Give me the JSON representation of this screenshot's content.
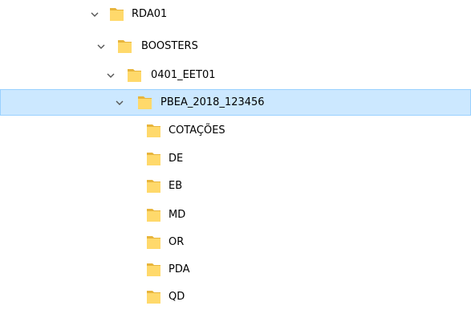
{
  "colors": {
    "selection_bg": "#cce8ff",
    "selection_border": "#99d1ff",
    "folder_body": "#ffd96b",
    "folder_back": "#e8b53c",
    "chevron": "#555555"
  },
  "tree": {
    "nodes": [
      {
        "label": "RDA01",
        "expanded": true,
        "selected": false
      },
      {
        "label": "BOOSTERS",
        "expanded": true,
        "selected": false
      },
      {
        "label": "0401_EET01",
        "expanded": true,
        "selected": false
      },
      {
        "label": "PBEA_2018_123456",
        "expanded": true,
        "selected": true
      },
      {
        "label": "COTAÇÕES",
        "expanded": false,
        "selected": false
      },
      {
        "label": "DE",
        "expanded": false,
        "selected": false
      },
      {
        "label": "EB",
        "expanded": false,
        "selected": false
      },
      {
        "label": "MD",
        "expanded": false,
        "selected": false
      },
      {
        "label": "OR",
        "expanded": false,
        "selected": false
      },
      {
        "label": "PDA",
        "expanded": false,
        "selected": false
      },
      {
        "label": "QD",
        "expanded": false,
        "selected": false
      }
    ]
  }
}
